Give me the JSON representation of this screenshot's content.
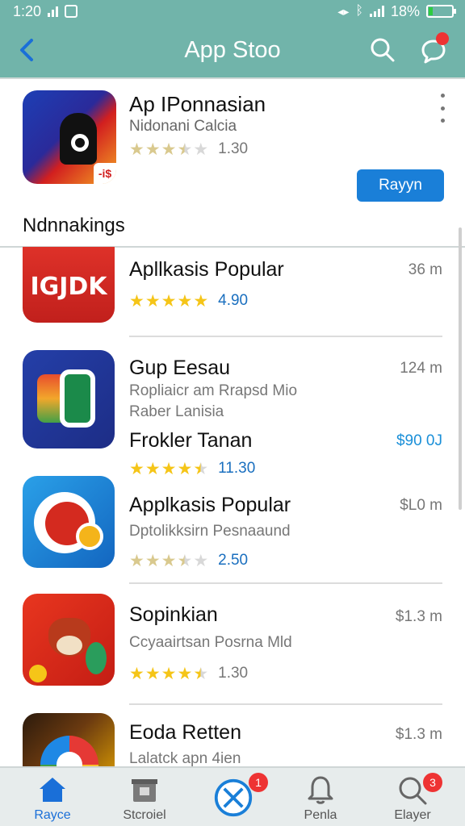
{
  "status": {
    "time": "1:20",
    "battery": "18%",
    "battery_level": 0.18
  },
  "header": {
    "title": "App Stoo",
    "back_icon": "back-chevron-icon",
    "search_icon": "search-icon",
    "chat_icon": "chat-bubble-icon"
  },
  "featured": {
    "name": "Ap IPonnasian",
    "developer": "Nidonani Calcia",
    "rating_stars": 3.5,
    "rating": "1.30",
    "icon_tag": "-i$",
    "action_label": "Rayyn"
  },
  "section": {
    "title": "Ndnnakings"
  },
  "apps": [
    {
      "name": "Apllkasis Popular",
      "sub1": "",
      "sub2": "",
      "meta": "36 m",
      "icon_text": "IGJDK",
      "rating_stars": 5,
      "rating": "4.90",
      "price": ""
    },
    {
      "name": "Gup Eesau",
      "sub1": "Ropliaicr am Rrapsd Mio",
      "sub2": "Raber Lanisia",
      "meta": "124 m",
      "extra_name": "Frokler Tanan",
      "price": "$90 0J",
      "rating_stars": 4.5,
      "rating": "11.30"
    },
    {
      "name": "Applkasis Popular",
      "sub1": "Dptolikksirn Pesnaaund",
      "sub2": "",
      "meta": "$L0 m",
      "rating_stars": 3.5,
      "rating": "2.50"
    },
    {
      "name": "Sopinkian",
      "sub1": "Ccyaairtsan Posrna Mld",
      "sub2": "",
      "meta": "$1.3 m",
      "rating_stars": 4.5,
      "rating": "1.30"
    },
    {
      "name": "Eoda Retten",
      "sub1": "Lalatck apn 4ien",
      "sub2": "",
      "meta": "$1.3 m"
    }
  ],
  "nav": [
    {
      "label": "Rayce",
      "icon": "home-icon",
      "active": true
    },
    {
      "label": "Stcroiel",
      "icon": "store-icon",
      "active": false
    },
    {
      "label": "",
      "icon": "close-circle-icon",
      "badge": "1",
      "active": false
    },
    {
      "label": "Penla",
      "icon": "bell-icon",
      "active": false
    },
    {
      "label": "Elayer",
      "icon": "search-icon",
      "badge": "3",
      "active": false
    }
  ],
  "colors": {
    "header": "#71b4aa",
    "accent": "#1a7fd8",
    "star": "#f5c518"
  }
}
